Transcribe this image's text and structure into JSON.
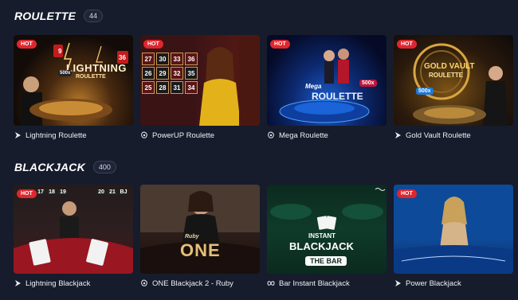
{
  "sections": [
    {
      "title": "ROULETTE",
      "count": "44",
      "games": [
        {
          "name": "Lightning Roulette",
          "hot": "HOT",
          "provider_icon": "evolution-icon",
          "art_text": "LIGHTNING",
          "art_sub": "ROULETTE",
          "art_nums": [
            "9",
            "36"
          ],
          "art_mult": "500x"
        },
        {
          "name": "PowerUP Roulette",
          "hot": "HOT",
          "provider_icon": "pragmatic-icon",
          "art_nums": [
            "27",
            "30",
            "33",
            "36",
            "26",
            "29",
            "32",
            "35",
            "25",
            "28",
            "31",
            "34"
          ]
        },
        {
          "name": "Mega Roulette",
          "hot": "HOT",
          "provider_icon": "pragmatic-icon",
          "art_text": "ROULETTE",
          "art_sub": "Mega",
          "art_mult": "500x"
        },
        {
          "name": "Gold Vault Roulette",
          "hot": "HOT",
          "provider_icon": "evolution-icon",
          "art_text": "GOLD VAULT",
          "art_sub": "ROULETTE",
          "art_mult": "500x"
        }
      ]
    },
    {
      "title": "BLACKJACK",
      "count": "400",
      "games": [
        {
          "name": "Lightning Blackjack",
          "hot": "HOT",
          "provider_icon": "evolution-icon",
          "art_nums": [
            "17",
            "18",
            "19",
            "20",
            "21",
            "BJ"
          ]
        },
        {
          "name": "ONE Blackjack 2 - Ruby",
          "hot": "",
          "provider_icon": "pragmatic-icon",
          "art_text": "ONE",
          "art_sub": "Ruby"
        },
        {
          "name": "Bar Instant Blackjack",
          "hot": "",
          "provider_icon": "infinity-icon",
          "art_text": "BLACKJACK",
          "art_sub": "INSTANT",
          "art_sub2": "THE BAR"
        },
        {
          "name": "Power Blackjack",
          "hot": "HOT",
          "provider_icon": "evolution-icon"
        }
      ]
    }
  ]
}
